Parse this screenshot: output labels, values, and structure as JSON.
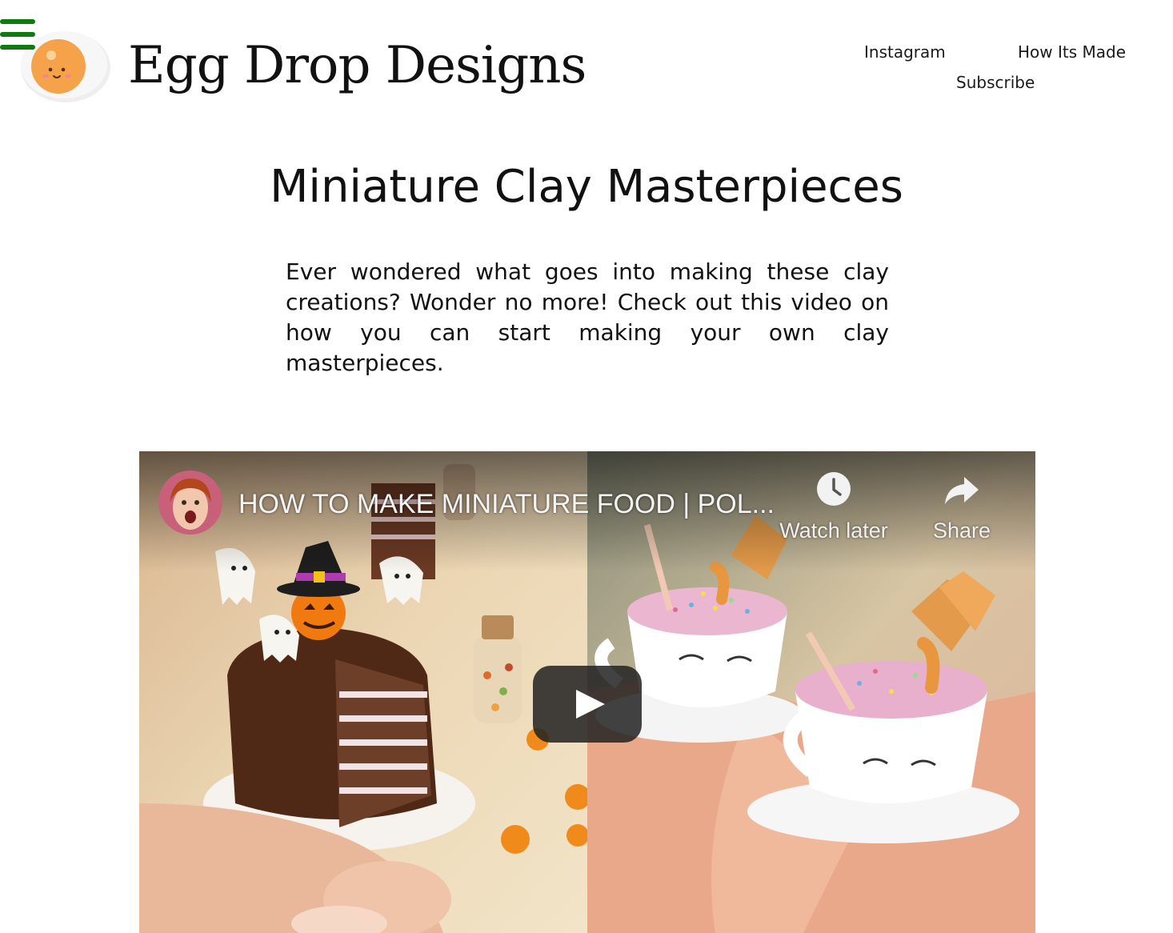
{
  "header": {
    "brand": "Egg Drop Designs",
    "nav": {
      "instagram": "Instagram",
      "how_its_made": "How Its Made",
      "subscribe": "Subscribe"
    },
    "menu_icon": "hamburger-menu-icon",
    "logo_icon": "fried-egg-logo"
  },
  "main": {
    "title": "Miniature Clay Masterpieces",
    "intro": "Ever wondered what goes into making these clay creations? Wonder no more! Check out this video on how you can start making your own clay masterpieces."
  },
  "video": {
    "title": "HOW TO MAKE MINIATURE FOOD | POL...",
    "actions": {
      "watch_later": "Watch later",
      "share": "Share"
    },
    "icons": {
      "watch_later": "clock-icon",
      "share": "share-arrow-icon",
      "play": "play-icon"
    }
  },
  "colors": {
    "menu_green": "#0f7a0f",
    "yolk": "#f5a24a",
    "play_button": "#212121"
  }
}
